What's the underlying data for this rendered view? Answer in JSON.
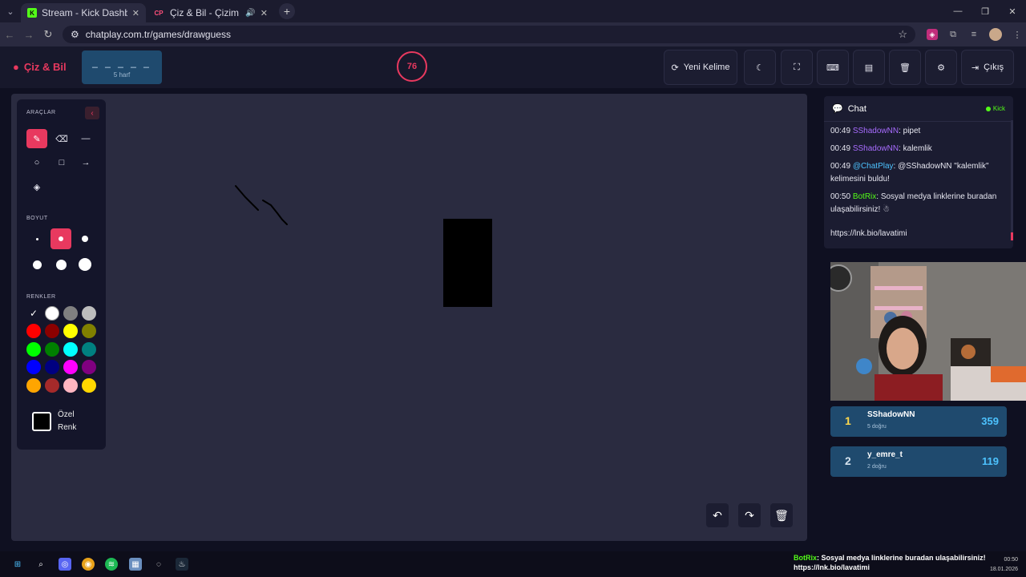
{
  "browser": {
    "tabs": [
      {
        "title": "Stream - Kick Dashboard",
        "favicon": "K",
        "active": true
      },
      {
        "title": "Çiz & Bil - Çizim Oyunu",
        "favicon": "CP",
        "active": false
      }
    ],
    "url": "chatplay.com.tr/games/drawguess"
  },
  "header": {
    "logo": "Çiz & Bil",
    "word_mask": "_ _ _ _ _",
    "word_hint": "5 harf",
    "timer": "76",
    "new_word": "Yeni Kelime",
    "exit": "Çıkış"
  },
  "toolbox": {
    "tools_label": "ARAÇLAR",
    "size_label": "BOYUT",
    "colors_label": "RENKLER",
    "custom_color_label": "Özel Renk",
    "colors": [
      "#000000",
      "#ffffff",
      "#808080",
      "#bdbdbd",
      "#ff0000",
      "#8b0000",
      "#ffff00",
      "#808000",
      "#00ff00",
      "#008000",
      "#00ffff",
      "#008080",
      "#0000ff",
      "#000080",
      "#ff00ff",
      "#800080",
      "#ffa500",
      "#a52a2a",
      "#ffb6c1",
      "#ffd700"
    ]
  },
  "chat": {
    "title": "Chat",
    "platform": "Kick",
    "messages": [
      {
        "time": "00:49",
        "user": "SShadowNN",
        "text": ": pipet",
        "color": "purple"
      },
      {
        "time": "00:49",
        "user": "SShadowNN",
        "text": ": kalemlik",
        "color": "purple"
      },
      {
        "time": "00:49",
        "user": "@ChatPlay",
        "text": ": @SShadowNN \"kalemlik\" kelimesini buldu!",
        "color": "blue"
      },
      {
        "time": "00:50",
        "user": "BotRix",
        "text": ": Sosyal medya linklerine buradan ulaşabilirsiniz! ☃",
        "color": "green"
      },
      {
        "time": "",
        "user": "",
        "text": "https://lnk.bio/lavatimi",
        "color": ""
      }
    ]
  },
  "leaderboard": [
    {
      "rank": "1",
      "name": "SShadowNN",
      "correct": "5 doğru",
      "score": "359"
    },
    {
      "rank": "2",
      "name": "y_emre_t",
      "correct": "2 doğru",
      "score": "119"
    }
  ],
  "taskbar": {
    "overlay_user": "BotRix",
    "overlay_msg": ": Sosyal medya linklerine buradan ulaşabilirsiniz!",
    "overlay_link": "https://lnk.bio/lavatimi",
    "time": "00:50",
    "date": "18.01.2026"
  }
}
